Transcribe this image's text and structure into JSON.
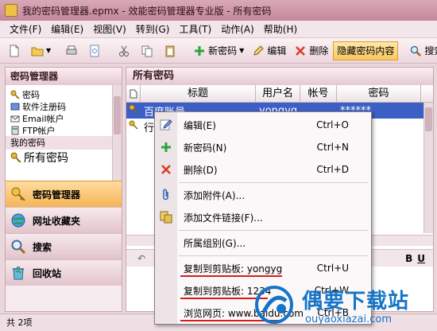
{
  "window": {
    "title": "我的密码管理器.epmx - 效能密码管理器专业版 - 所有密码"
  },
  "menu": [
    "文件(F)",
    "编辑(E)",
    "视图(V)",
    "转到(G)",
    "工具(T)",
    "动作(A)",
    "帮助(H)"
  ],
  "toolbar": {
    "new_label": "新密码",
    "edit_label": "编辑",
    "delete_label": "删除",
    "hide_label": "隐藏密码内容",
    "search_label": "搜索"
  },
  "left": {
    "header": "密码管理器",
    "tree": [
      "密码",
      "软件注册码",
      "Email帐户",
      "FTP帐户"
    ],
    "group": "我的密码",
    "selected": "所有密码",
    "nav": [
      "密码管理器",
      "网址收藏夹",
      "搜索",
      "回收站"
    ]
  },
  "right": {
    "header": "所有密码",
    "columns": [
      "标题",
      "用户名",
      "帐号",
      "密码"
    ],
    "rows": [
      {
        "title": "百度账号",
        "user": "yongyg",
        "account": "",
        "password": "******"
      },
      {
        "title": "行",
        "user": "",
        "account": "",
        "password": ""
      }
    ]
  },
  "context_menu": [
    {
      "label": "编辑(E)",
      "shortcut": "Ctrl+O"
    },
    {
      "label": "新密码(N)",
      "shortcut": "Ctrl+N"
    },
    {
      "label": "删除(D)",
      "shortcut": "Ctrl+D"
    },
    {
      "label": "添加附件(A)...",
      "shortcut": ""
    },
    {
      "label": "添加文件链接(F)...",
      "shortcut": ""
    },
    {
      "label": "所属组别(G)...",
      "shortcut": ""
    },
    {
      "label": "复制到剪贴板: yongyg",
      "shortcut": "Ctrl+U"
    },
    {
      "label": "复制到剪贴板: 1234",
      "shortcut": "Ctrl+W"
    },
    {
      "label": "浏览网页: www.baidu.com",
      "shortcut": "Ctrl+B"
    }
  ],
  "status": {
    "text": "共 2项"
  },
  "watermark": {
    "brand": "偶要下载站",
    "url": "ouyaoxiazai.com"
  },
  "colors": {
    "accent": "#f5b556",
    "selection": "#3b5fc5",
    "titlebar": "#c48799",
    "annotation": "#d81b1b",
    "watermark": "#1574c8"
  }
}
